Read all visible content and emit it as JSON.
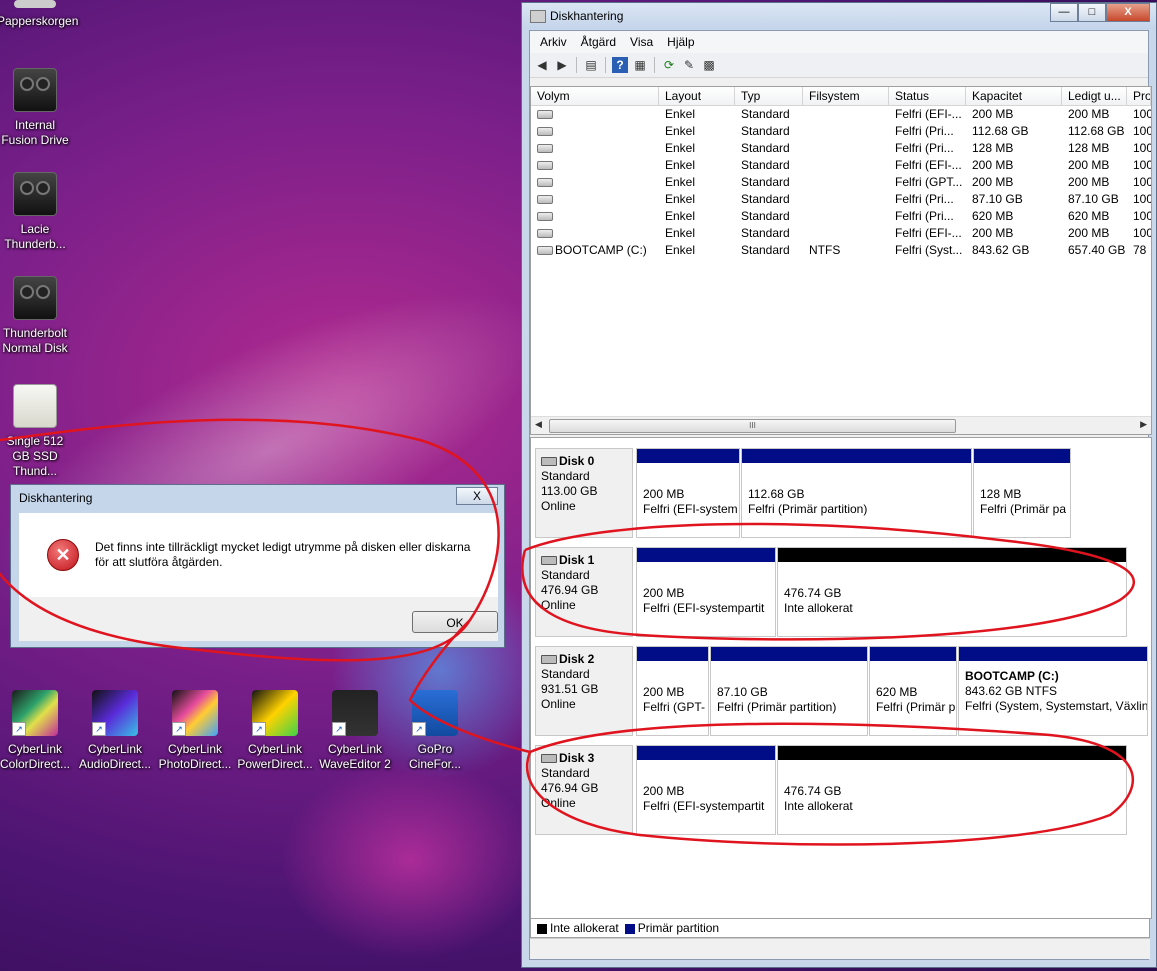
{
  "desktop": {
    "icons": [
      {
        "label": "Papperskorgen",
        "kind": "bin"
      },
      {
        "label": "Internal Fusion Drive",
        "kind": "disk"
      },
      {
        "label": "Lacie Thunderb...",
        "kind": "disk"
      },
      {
        "label": "Thunderbolt Normal Disk",
        "kind": "disk"
      },
      {
        "label": "Single 512 GB SSD Thund...",
        "kind": "ssd"
      }
    ],
    "apps": [
      {
        "label": "CyberLink ColorDirect...",
        "icon": "colordirector-icon"
      },
      {
        "label": "CyberLink AudioDirect...",
        "icon": "audiodirector-icon"
      },
      {
        "label": "CyberLink PhotoDirect...",
        "icon": "photodirector-icon"
      },
      {
        "label": "CyberLink PowerDirect...",
        "icon": "powerdirector-icon"
      },
      {
        "label": "CyberLink WaveEditor 2",
        "icon": "waveeditor-icon"
      },
      {
        "label": "GoPro CineFor...",
        "icon": "gopro-icon"
      }
    ]
  },
  "window": {
    "title": "Diskhantering",
    "buttons": {
      "minimize": "—",
      "maximize": "□",
      "close": "X"
    },
    "menu": [
      "Arkiv",
      "Åtgärd",
      "Visa",
      "Hjälp"
    ],
    "columns": [
      "Volym",
      "Layout",
      "Typ",
      "Filsystem",
      "Status",
      "Kapacitet",
      "Ledigt u...",
      "Pro"
    ],
    "rows": [
      [
        "",
        "Enkel",
        "Standard",
        "",
        "Felfri (EFI-...",
        "200 MB",
        "200 MB",
        "100"
      ],
      [
        "",
        "Enkel",
        "Standard",
        "",
        "Felfri (Pri...",
        "112.68 GB",
        "112.68 GB",
        "100"
      ],
      [
        "",
        "Enkel",
        "Standard",
        "",
        "Felfri (Pri...",
        "128 MB",
        "128 MB",
        "100"
      ],
      [
        "",
        "Enkel",
        "Standard",
        "",
        "Felfri (EFI-...",
        "200 MB",
        "200 MB",
        "100"
      ],
      [
        "",
        "Enkel",
        "Standard",
        "",
        "Felfri (GPT...",
        "200 MB",
        "200 MB",
        "100"
      ],
      [
        "",
        "Enkel",
        "Standard",
        "",
        "Felfri (Pri...",
        "87.10 GB",
        "87.10 GB",
        "100"
      ],
      [
        "",
        "Enkel",
        "Standard",
        "",
        "Felfri (Pri...",
        "620 MB",
        "620 MB",
        "100"
      ],
      [
        "",
        "Enkel",
        "Standard",
        "",
        "Felfri (EFI-...",
        "200 MB",
        "200 MB",
        "100"
      ],
      [
        "BOOTCAMP (C:)",
        "Enkel",
        "Standard",
        "NTFS",
        "Felfri (Syst...",
        "843.62 GB",
        "657.40 GB",
        "78"
      ]
    ],
    "scroll_thumb": "III",
    "disks": [
      {
        "name": "Disk 0",
        "type": "Standard",
        "size": "113.00 GB",
        "state": "Online",
        "parts": [
          {
            "kind": "prim",
            "l1": "",
            "l2": "200 MB",
            "l3": "Felfri (EFI-system"
          },
          {
            "kind": "prim",
            "l1": "",
            "l2": "112.68 GB",
            "l3": "Felfri (Primär partition)"
          },
          {
            "kind": "prim",
            "l1": "",
            "l2": "128 MB",
            "l3": "Felfri (Primär pa"
          }
        ]
      },
      {
        "name": "Disk 1",
        "type": "Standard",
        "size": "476.94 GB",
        "state": "Online",
        "parts": [
          {
            "kind": "prim",
            "l1": "",
            "l2": "200 MB",
            "l3": "Felfri (EFI-systempartit"
          },
          {
            "kind": "unal",
            "l1": "",
            "l2": "476.74 GB",
            "l3": "Inte allokerat"
          }
        ]
      },
      {
        "name": "Disk 2",
        "type": "Standard",
        "size": "931.51 GB",
        "state": "Online",
        "parts": [
          {
            "kind": "prim",
            "l1": "",
            "l2": "200 MB",
            "l3": "Felfri (GPT-"
          },
          {
            "kind": "prim",
            "l1": "",
            "l2": "87.10 GB",
            "l3": "Felfri (Primär partition)"
          },
          {
            "kind": "prim",
            "l1": "",
            "l2": "620 MB",
            "l3": "Felfri (Primär p"
          },
          {
            "kind": "prim",
            "l1": "BOOTCAMP  (C:)",
            "l2": "843.62 GB NTFS",
            "l3": "Felfri (System, Systemstart, Växlin"
          }
        ]
      },
      {
        "name": "Disk 3",
        "type": "Standard",
        "size": "476.94 GB",
        "state": "Online",
        "parts": [
          {
            "kind": "prim",
            "l1": "",
            "l2": "200 MB",
            "l3": "Felfri (EFI-systempartit"
          },
          {
            "kind": "unal",
            "l1": "",
            "l2": "476.74 GB",
            "l3": "Inte allokerat"
          }
        ]
      }
    ],
    "legend": [
      {
        "label": "Inte allokerat",
        "color": "#000000"
      },
      {
        "label": "Primär partition",
        "color": "#010c87"
      }
    ]
  },
  "dialog": {
    "title": "Diskhantering",
    "close": "X",
    "message_line1": "Det finns inte tillräckligt mycket ledigt utrymme på disken eller diskarna",
    "message_line2": "för att slutföra åtgärden.",
    "ok": "OK",
    "icon": "error-icon"
  },
  "colors": {
    "primary_partition": "#010c87",
    "unallocated": "#000000",
    "annotation": "#e0141e"
  }
}
